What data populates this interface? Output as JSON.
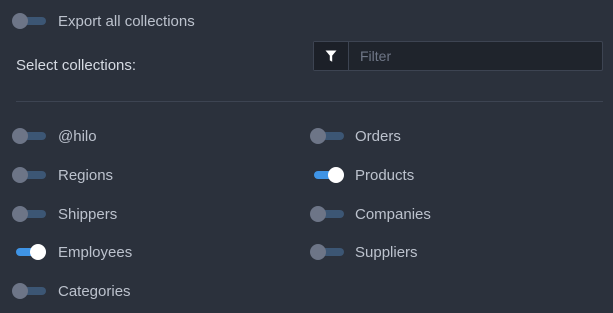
{
  "export_all": {
    "label": "Export all collections",
    "enabled": false
  },
  "select_label": "Select collections:",
  "filter": {
    "placeholder": "Filter",
    "value": "",
    "icon": "filter-funnel-icon"
  },
  "collections": [
    {
      "name": "@hilo",
      "enabled": false
    },
    {
      "name": "Orders",
      "enabled": false
    },
    {
      "name": "Regions",
      "enabled": false
    },
    {
      "name": "Products",
      "enabled": true
    },
    {
      "name": "Shippers",
      "enabled": false
    },
    {
      "name": "Companies",
      "enabled": false
    },
    {
      "name": "Employees",
      "enabled": true
    },
    {
      "name": "Suppliers",
      "enabled": false
    },
    {
      "name": "Categories",
      "enabled": false
    }
  ],
  "colors": {
    "background": "#2b313c",
    "toggle_on": "#3f94e6",
    "toggle_off_track": "#3c5674",
    "toggle_off_knob": "#6d7587"
  }
}
